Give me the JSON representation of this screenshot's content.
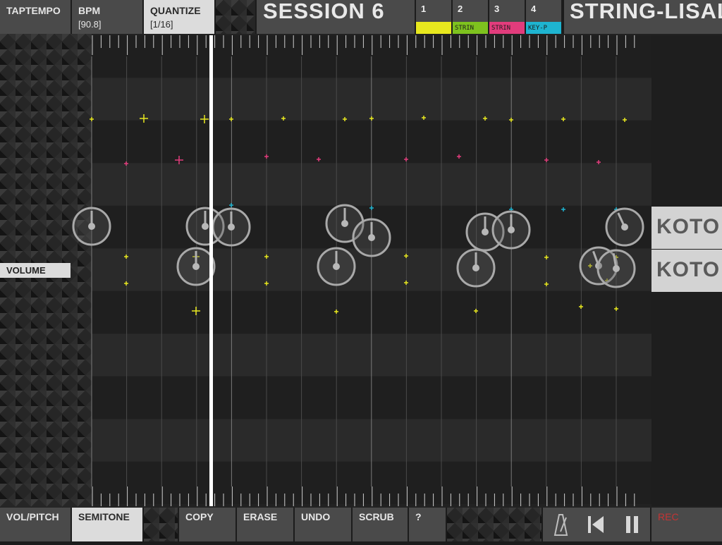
{
  "top": {
    "taptempo": "TAPTEMPO",
    "bpm_label": "BPM",
    "bpm_value": "[90.8]",
    "quantize_label": "QUANTIZE",
    "quantize_value": "[1/16]",
    "session": "SESSION  6",
    "title": "STRING-LISAL"
  },
  "tracks": [
    {
      "num": "1",
      "strip": "",
      "color": "#e8e81e"
    },
    {
      "num": "2",
      "strip": "STRIN",
      "color": "#7ec21e"
    },
    {
      "num": "3",
      "strip": "STRIN",
      "color": "#e23c7c"
    },
    {
      "num": "4",
      "strip": "KEY-P",
      "color": "#1eb4d0"
    }
  ],
  "side": {
    "volume": "VOLUME"
  },
  "lanes": {
    "koto_1": "KOTO",
    "koto_2": "KOTO"
  },
  "bottom": {
    "volpitch": "VOL/PITCH",
    "semitone": "SEMITONE",
    "copy": "COPY",
    "erase": "ERASE",
    "undo": "UNDO",
    "scrub": "SCRUB",
    "help": "?",
    "rec": "REC"
  },
  "icons": {
    "metronome": "metronome-icon",
    "rewind": "skip-back-icon",
    "pause": "pause-icon"
  },
  "colors": {
    "yellow": "#e8e81e",
    "pink": "#e23c7c",
    "cyan": "#1eb4d0",
    "playhead": "#ffffff"
  }
}
